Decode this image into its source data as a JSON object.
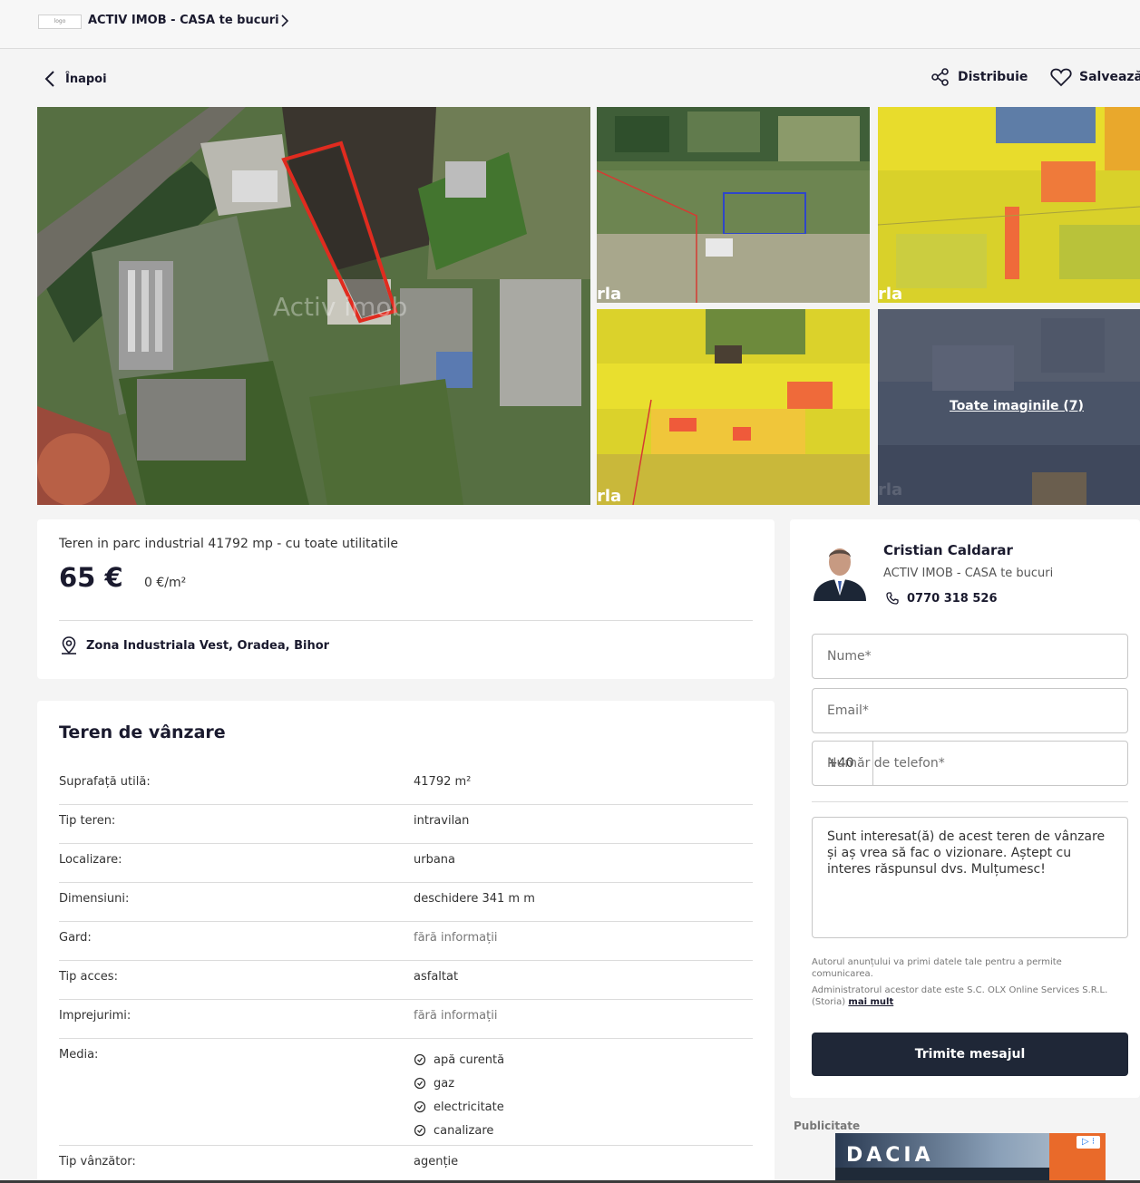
{
  "header": {
    "agency_logo_alt": "logo",
    "agency_name": "ACTIV IMOB - CASA te bucuri",
    "chevron_icon": "chevron-right-icon"
  },
  "nav": {
    "back_label": "Înapoi",
    "back_icon": "chevron-left-icon",
    "share_label": "Distribuie",
    "share_icon": "share-icon",
    "save_label": "Salvează",
    "save_icon": "heart-icon"
  },
  "gallery": {
    "all_images_label": "Toate imaginile (7)",
    "watermark_main": "Activ imob",
    "watermark_thumb": "rla"
  },
  "summary": {
    "title": "Teren in parc industrial 41792 mp - cu toate utilitatile",
    "price": "65 €",
    "price_per_sqm": "0 €/m²",
    "location": "Zona Industriala Vest, Oradea, Bihor",
    "location_icon": "map-pin-icon"
  },
  "details": {
    "section_title": "Teren de vânzare",
    "rows": [
      {
        "key": "Suprafață utilă:",
        "value": "41792 m²"
      },
      {
        "key": "Tip teren:",
        "value": "intravilan"
      },
      {
        "key": "Localizare:",
        "value": "urbana"
      },
      {
        "key": "Dimensiuni:",
        "value": "deschidere 341 m m"
      },
      {
        "key": "Gard:",
        "value": "fără informații"
      },
      {
        "key": "Tip acces:",
        "value": "asfaltat"
      },
      {
        "key": "Imprejurimi:",
        "value": "fără informații"
      },
      {
        "key": "Media:",
        "items": [
          "apă curentă",
          "gaz",
          "electricitate",
          "canalizare"
        ]
      },
      {
        "key": "Tip vânzător:",
        "value": "agenție"
      }
    ]
  },
  "contact": {
    "agent_name": "Cristian Caldarar",
    "agency": "ACTIV IMOB - CASA te bucuri",
    "phone": "0770 318 526",
    "phone_icon": "phone-icon",
    "name_placeholder": "Nume*",
    "email_placeholder": "Email*",
    "phone_prefix": "+40",
    "phone_placeholder": "Număr de telefon*",
    "message": "Sunt interesat(ă) de acest teren de vânzare și aș vrea să fac o vizionare. Aștept cu interes răspunsul dvs. Mulțumesc!",
    "disclaimer_1": "Autorul anunțului va primi datele tale pentru a permite comunicarea.",
    "disclaimer_2": "Administratorul acestor date este S.C. OLX Online Services S.R.L. (Storia)",
    "more_link": "mai mult",
    "send_label": "Trimite mesajul"
  },
  "ad": {
    "label": "Publicitate",
    "brand": "DACIA",
    "info_icon": "ad-choices-icon"
  }
}
